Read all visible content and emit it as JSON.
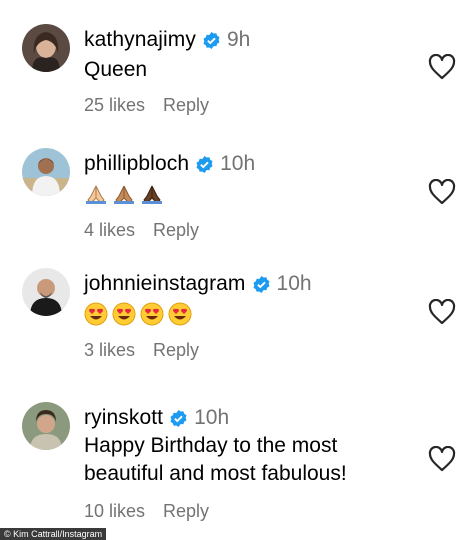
{
  "comments": [
    {
      "username": "kathynajimy",
      "time": "9h",
      "text": "Queen",
      "likes": "25 likes",
      "reply": "Reply"
    },
    {
      "username": "phillipbloch",
      "time": "10h",
      "emoji_icons": [
        "folded-hands-icon",
        "folded-hands-icon",
        "folded-hands-icon"
      ],
      "likes": "4 likes",
      "reply": "Reply"
    },
    {
      "username": "johnnieinstagram",
      "time": "10h",
      "emoji_icons": [
        "heart-eyes-icon",
        "heart-eyes-icon",
        "heart-eyes-icon",
        "heart-eyes-icon"
      ],
      "likes": "3 likes",
      "reply": "Reply"
    },
    {
      "username": "ryinskott",
      "time": "10h",
      "text_line1": "Happy Birthday to the most",
      "text_line2": "beautiful and most fabulous!",
      "likes": "10 likes",
      "reply": "Reply"
    }
  ],
  "caption": "© Kim Cattrall/Instagram",
  "colors": {
    "verified": "#1d9bf0",
    "secondary_text": "#737373",
    "heart_outline": "#262626"
  }
}
